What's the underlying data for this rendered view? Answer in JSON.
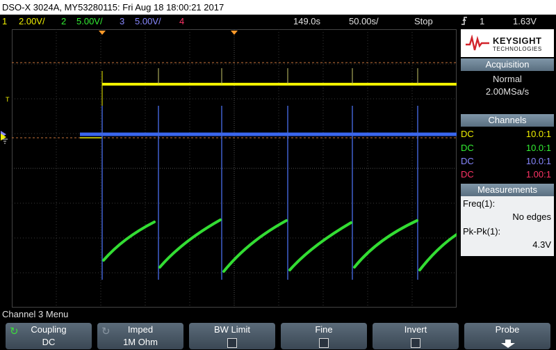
{
  "titlebar": {
    "text": "DSO-X 3024A, MY53280115: Fri Aug 18 18:00:21 2017"
  },
  "status": {
    "ch1_num": "1",
    "ch1_scale": "2.00V/",
    "ch2_num": "2",
    "ch2_scale": "5.00V/",
    "ch3_num": "3",
    "ch3_scale": "5.00V/",
    "ch4_num": "4",
    "delay": "149.0s",
    "timebase": "50.00s/",
    "run_state": "Stop",
    "trigger_icon": "trigger-edge-icon",
    "trigger_channel": "1",
    "trigger_level": "1.63V"
  },
  "logo": {
    "brand": "KEYSIGHT",
    "sub": "TECHNOLOGIES"
  },
  "acquisition": {
    "header": "Acquisition",
    "mode": "Normal",
    "rate": "2.00MSa/s"
  },
  "channels": {
    "header": "Channels",
    "rows": [
      {
        "coupling": "DC",
        "probe": "10.0:1",
        "color": "#f0f000"
      },
      {
        "coupling": "DC",
        "probe": "10.0:1",
        "color": "#33ee33"
      },
      {
        "coupling": "DC",
        "probe": "10.0:1",
        "color": "#8888ff"
      },
      {
        "coupling": "DC",
        "probe": "1.00:1",
        "color": "#ff3366"
      }
    ]
  },
  "measurements": {
    "header": "Measurements",
    "freq_label": "Freq(1):",
    "freq_value": "No edges",
    "pkpk_label": "Pk-Pk(1):",
    "pkpk_value": "4.3V"
  },
  "marker": {
    "trigger_level": "T"
  },
  "menu": {
    "title": "Channel 3 Menu"
  },
  "softkeys": [
    {
      "label": "Coupling",
      "value": "DC"
    },
    {
      "label": "Imped",
      "value": "1M Ohm"
    },
    {
      "label": "BW Limit"
    },
    {
      "label": "Fine"
    },
    {
      "label": "Invert"
    },
    {
      "label": "Probe"
    }
  ]
}
